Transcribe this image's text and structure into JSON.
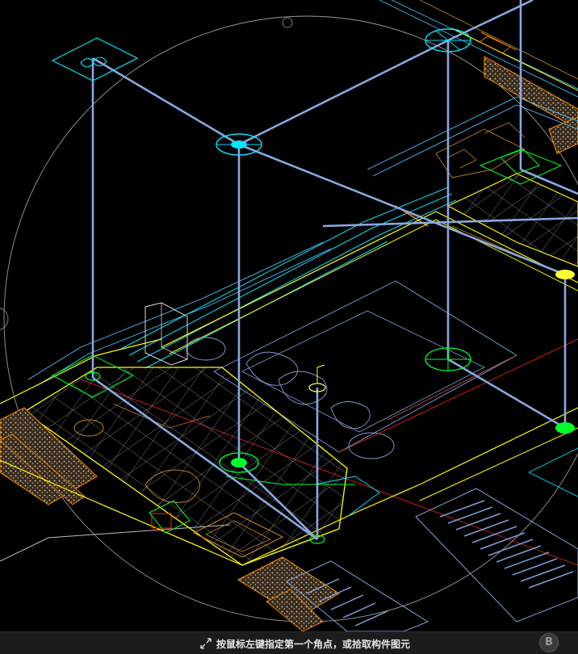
{
  "status_bar": {
    "prompt": "按鼠标左键指定第一个角点，或拾取构件图元",
    "prompt_icon": "corner-select-icon",
    "badge": "B"
  },
  "drawing": {
    "background": "#000000",
    "pipe_color": "#7f9fd9",
    "wall_color": "#ffff00",
    "tile_color": "#8a8a8a",
    "fixture_color": "#ff8c00",
    "cyan_color": "#00e5ff",
    "fitting_green": "#00ff2a",
    "fitting_yellow": "#ffff33"
  }
}
